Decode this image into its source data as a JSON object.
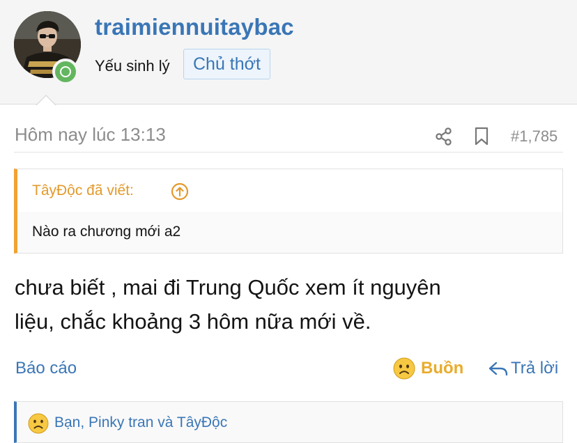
{
  "user": {
    "username": "traimiennuitaybac",
    "title": "Yếu sinh lý",
    "op_badge": "Chủ thớt",
    "avatar_icon": "user-avatar",
    "status_icon": "online-status-icon"
  },
  "post": {
    "date": "Hôm nay lúc 13:13",
    "number": "#1,785",
    "quote": {
      "author_label": "TâyĐộc đã viết:",
      "text": "Nào ra chương mới a2"
    },
    "message_line1": "chưa biết , mai đi Trung Quốc xem ít nguyên",
    "message_line2": "liệu, chắc khoảng 3 hôm nữa mới về."
  },
  "actions": {
    "report": "Báo cáo",
    "reaction": "Buồn",
    "reply": "Trả lời"
  },
  "reactions_summary": "Bạn, Pinky tran và TâyĐộc",
  "colors": {
    "link": "#3a76b6",
    "quote_accent": "#f1a231",
    "reaction_accent": "#e9ac2d",
    "online": "#63b65f"
  }
}
